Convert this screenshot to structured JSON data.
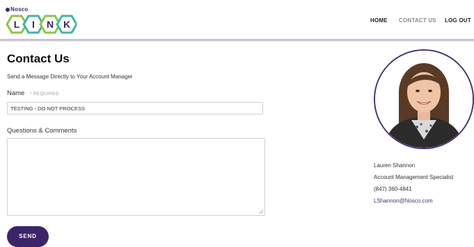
{
  "brand": {
    "company": "Nosco",
    "letters": [
      "L",
      "I",
      "N",
      "K"
    ]
  },
  "nav": {
    "home": "HOME",
    "contact": "CONTACT US",
    "logout": "LOG OUT"
  },
  "form": {
    "title": "Contact Us",
    "subtitle": "Send a Message Directly to Your Account Manager",
    "name_label": "Name",
    "required_label": "* REQUIRED",
    "name_value": "TESTING - DO NOT PROCESS",
    "comments_label": "Questions & Comments",
    "comments_value": "",
    "send_label": "SEND"
  },
  "contact": {
    "name": "Lauren Shannon",
    "title": "Account Management Specialist",
    "phone": "(847) 360-4841",
    "email": "LShannon@Nosco.com"
  },
  "colors": {
    "primary": "#3b2568",
    "hex_green": "#8cc63f",
    "hex_teal": "#39b8a8",
    "nav_inactive": "#8b8b8b"
  }
}
